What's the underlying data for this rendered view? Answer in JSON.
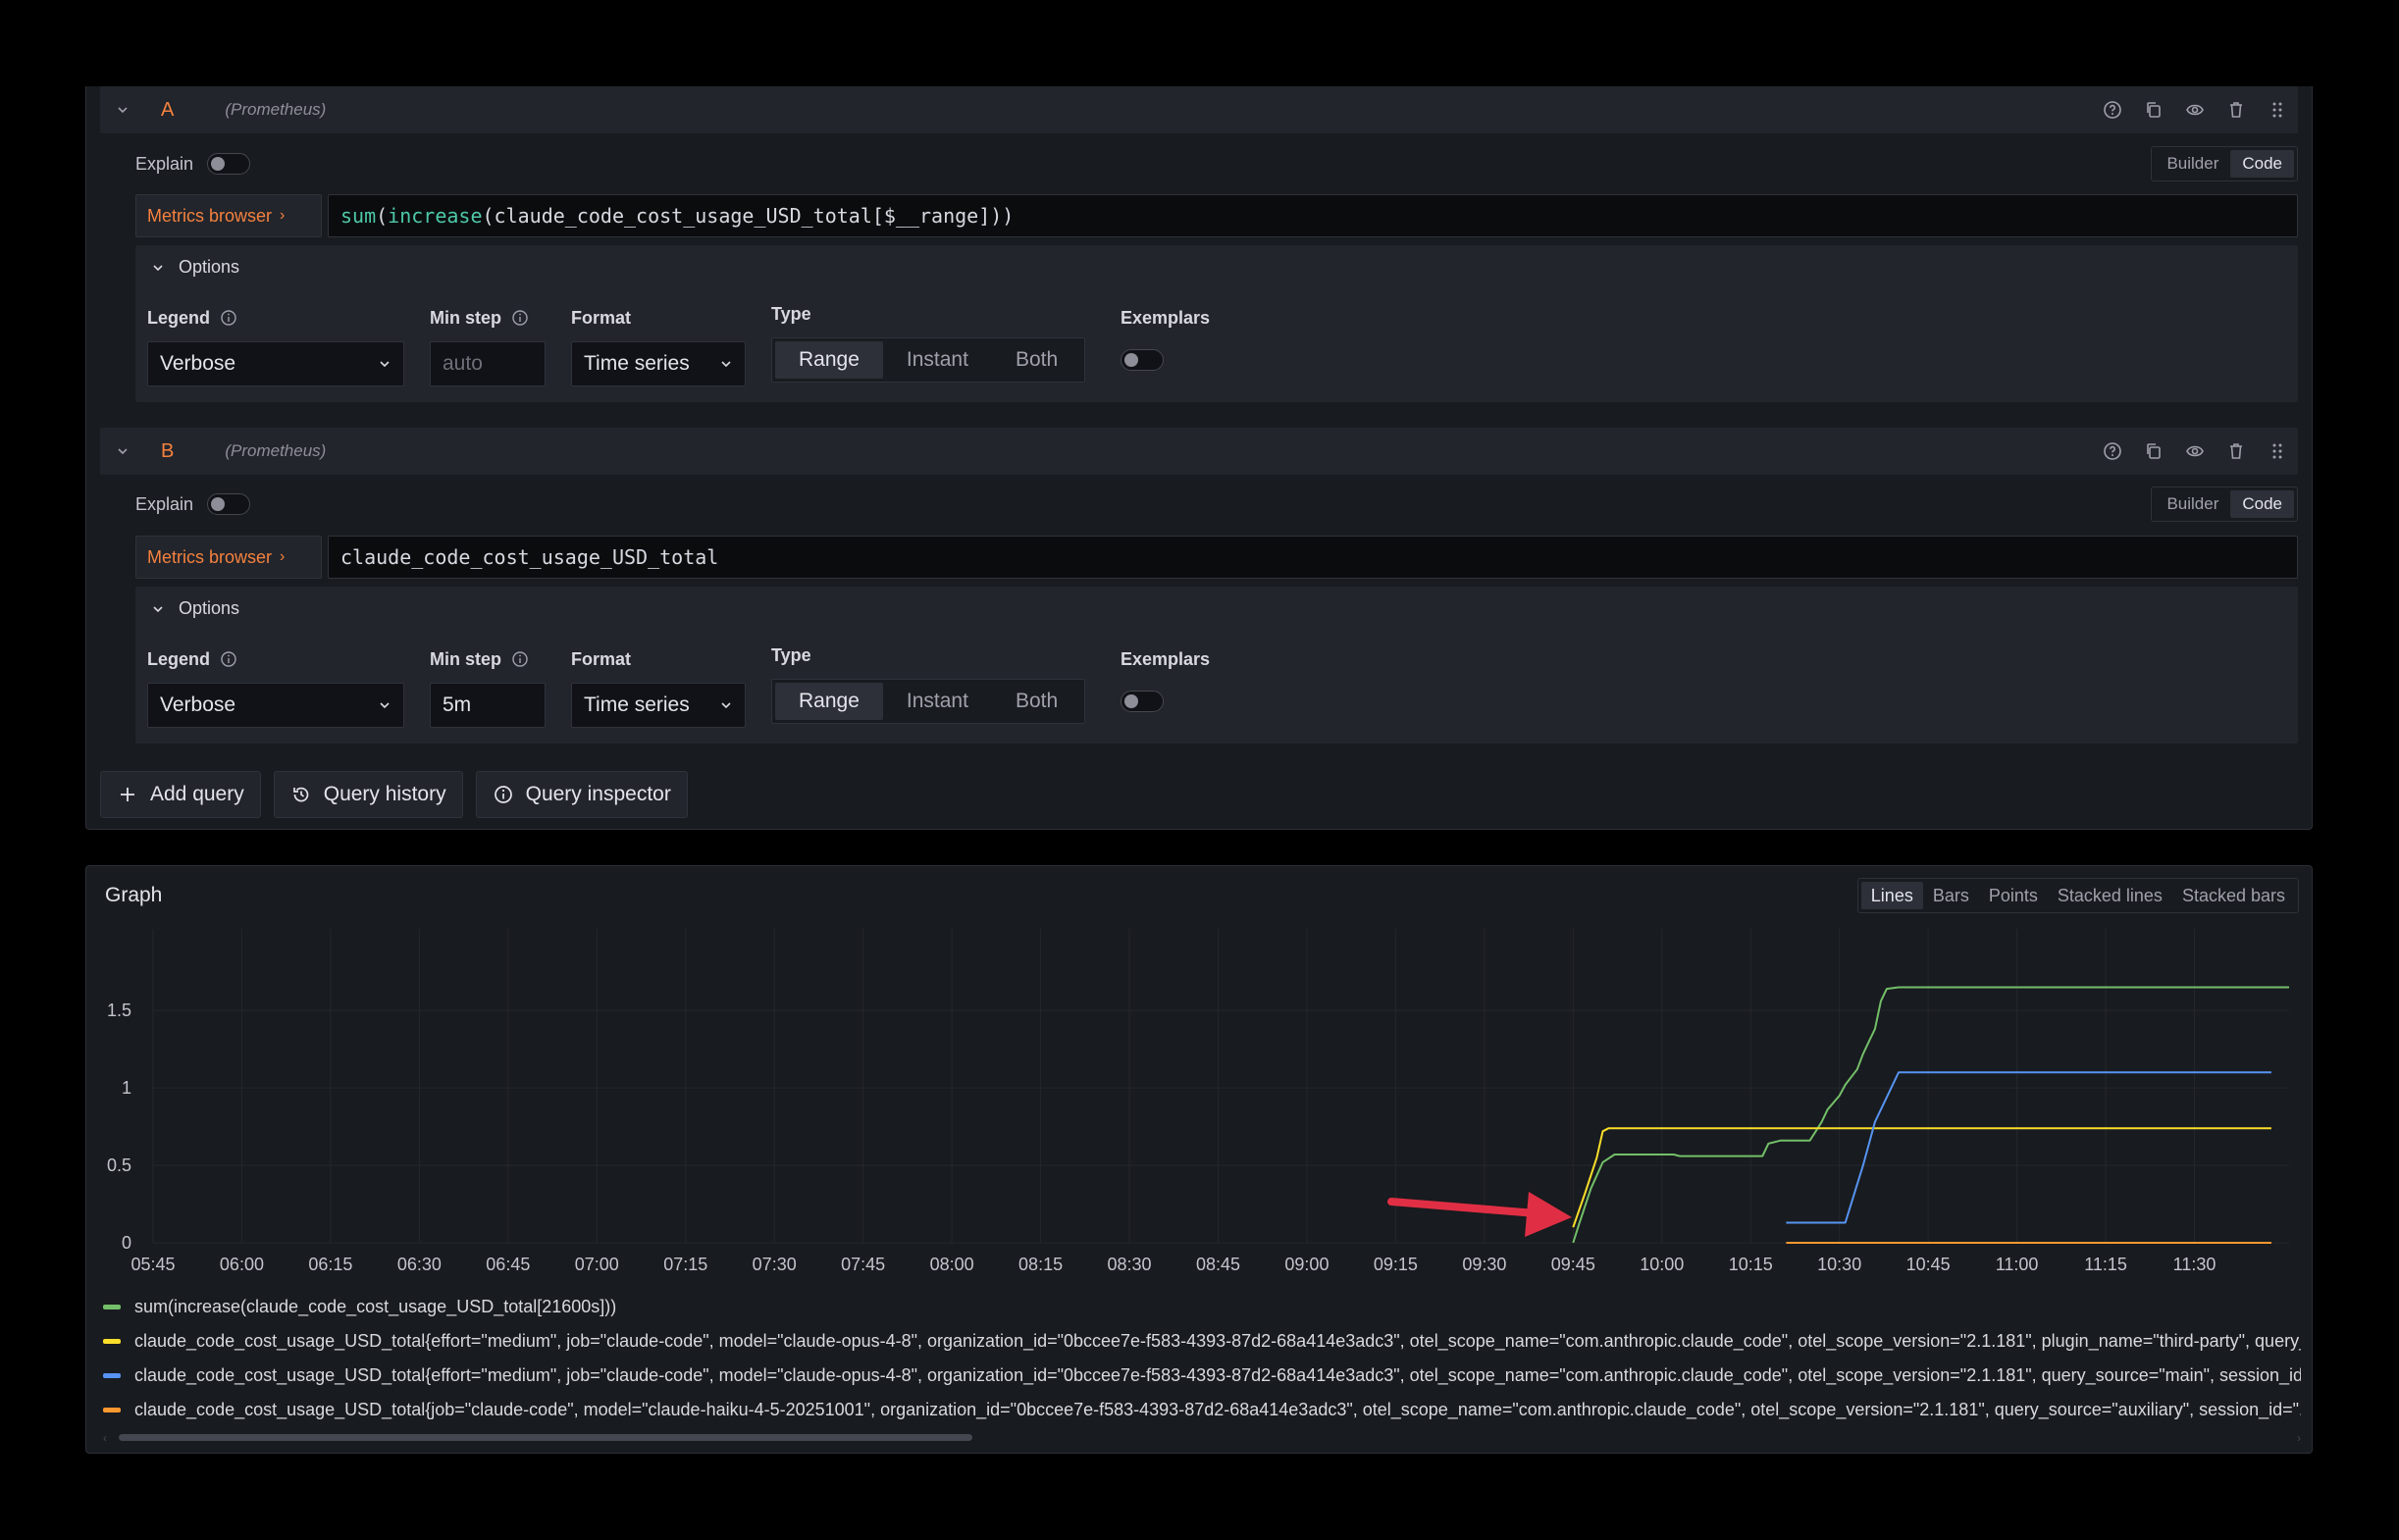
{
  "queries": [
    {
      "refid": "A",
      "datasource": "(Prometheus)",
      "explain_label": "Explain",
      "mode_builder": "Builder",
      "mode_code": "Code",
      "metrics_browser": "Metrics browser",
      "expr_parts": {
        "fn1": "sum",
        "p1": "(",
        "fn2": "increase",
        "rest": "(claude_code_cost_usage_USD_total[$__range]))"
      },
      "options_title": "Options",
      "legend_label": "Legend",
      "legend_value": "Verbose",
      "min_step_label": "Min step",
      "min_step_value": "",
      "min_step_placeholder": "auto",
      "format_label": "Format",
      "format_value": "Time series",
      "type_label": "Type",
      "type_options": [
        "Range",
        "Instant",
        "Both"
      ],
      "exemplars_label": "Exemplars"
    },
    {
      "refid": "B",
      "datasource": "(Prometheus)",
      "explain_label": "Explain",
      "mode_builder": "Builder",
      "mode_code": "Code",
      "metrics_browser": "Metrics browser",
      "expr": "claude_code_cost_usage_USD_total",
      "options_title": "Options",
      "legend_label": "Legend",
      "legend_value": "Verbose",
      "min_step_label": "Min step",
      "min_step_value": "5m",
      "format_label": "Format",
      "format_value": "Time series",
      "type_label": "Type",
      "type_options": [
        "Range",
        "Instant",
        "Both"
      ],
      "exemplars_label": "Exemplars"
    }
  ],
  "actions": {
    "add_query": "Add query",
    "query_history": "Query history",
    "query_inspector": "Query inspector"
  },
  "graph": {
    "title": "Graph",
    "viz_options": [
      "Lines",
      "Bars",
      "Points",
      "Stacked lines",
      "Stacked bars"
    ],
    "viz_selected": "Lines",
    "legend": [
      "sum(increase(claude_code_cost_usage_USD_total[21600s]))",
      "claude_code_cost_usage_USD_total{effort=\"medium\", job=\"claude-code\", model=\"claude-opus-4-8\", organization_id=\"0bccee7e-f583-4393-87d2-68a414e3adc3\", otel_scope_name=\"com.anthropic.claude_code\", otel_scope_version=\"2.1.181\", plugin_name=\"third-party\", query_source=\"main\", session_id=\"...\"}",
      "claude_code_cost_usage_USD_total{effort=\"medium\", job=\"claude-code\", model=\"claude-opus-4-8\", organization_id=\"0bccee7e-f583-4393-87d2-68a414e3adc3\", otel_scope_name=\"com.anthropic.claude_code\", otel_scope_version=\"2.1.181\", query_source=\"main\", session_id=\"...\"}",
      "claude_code_cost_usage_USD_total{job=\"claude-code\", model=\"claude-haiku-4-5-20251001\", organization_id=\"0bccee7e-f583-4393-87d2-68a414e3adc3\", otel_scope_name=\"com.anthropic.claude_code\", otel_scope_version=\"2.1.181\", query_source=\"auxiliary\", session_id=\"...\"}"
    ]
  },
  "chart_data": {
    "type": "line",
    "x_ticks": [
      "05:45",
      "06:00",
      "06:15",
      "06:30",
      "06:45",
      "07:00",
      "07:15",
      "07:30",
      "07:45",
      "08:00",
      "08:15",
      "08:30",
      "08:45",
      "09:00",
      "09:15",
      "09:30",
      "09:45",
      "10:00",
      "10:15",
      "10:30",
      "10:45",
      "11:00",
      "11:15",
      "11:30"
    ],
    "y_ticks": [
      "0",
      "0.5",
      "1",
      "1.5"
    ],
    "x_range": [
      "05:45",
      "11:46"
    ],
    "ylim": [
      0,
      1.9
    ],
    "grid": true,
    "legend_placement": "bottom",
    "series": [
      {
        "color": "#73bf69",
        "points": [
          [
            "09:45",
            0
          ],
          [
            "09:46",
            0.12
          ],
          [
            "09:48",
            0.35
          ],
          [
            "09:50",
            0.52
          ],
          [
            "09:52",
            0.57
          ],
          [
            "10:02",
            0.57
          ],
          [
            "10:03",
            0.56
          ],
          [
            "10:17",
            0.56
          ],
          [
            "10:18",
            0.64
          ],
          [
            "10:20",
            0.66
          ],
          [
            "10:25",
            0.66
          ],
          [
            "10:26",
            0.72
          ],
          [
            "10:27",
            0.78
          ],
          [
            "10:28",
            0.86
          ],
          [
            "10:30",
            0.95
          ],
          [
            "10:31",
            1.02
          ],
          [
            "10:33",
            1.12
          ],
          [
            "10:34",
            1.22
          ],
          [
            "10:35",
            1.3
          ],
          [
            "10:36",
            1.38
          ],
          [
            "10:37",
            1.56
          ],
          [
            "10:38",
            1.64
          ],
          [
            "10:40",
            1.65
          ],
          [
            "11:46",
            1.65
          ]
        ]
      },
      {
        "color": "#fade2a",
        "points": [
          [
            "09:45",
            0.1
          ],
          [
            "09:47",
            0.32
          ],
          [
            "09:49",
            0.55
          ],
          [
            "09:50",
            0.72
          ],
          [
            "09:51",
            0.74
          ],
          [
            "11:43",
            0.74
          ]
        ]
      },
      {
        "color": "#5794f2",
        "points": [
          [
            "10:21",
            0.13
          ],
          [
            "10:31",
            0.13
          ],
          [
            "10:34",
            0.5
          ],
          [
            "10:36",
            0.78
          ],
          [
            "10:40",
            1.1
          ],
          [
            "11:43",
            1.1
          ]
        ]
      },
      {
        "color": "#ff9830",
        "points": [
          [
            "10:21",
            0
          ],
          [
            "11:43",
            0
          ]
        ]
      }
    ]
  },
  "colors": {
    "accent": "#f5813f",
    "annotation_arrow": "#e02f44"
  }
}
